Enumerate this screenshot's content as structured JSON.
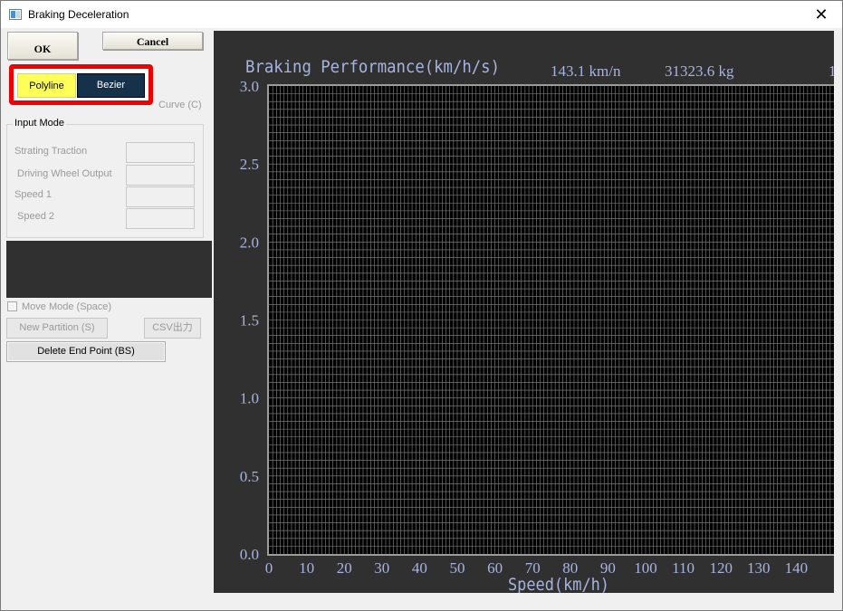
{
  "window": {
    "title": "Braking Deceleration",
    "close_glyph": "✕"
  },
  "buttons": {
    "ok": "OK",
    "cancel": "Cancel"
  },
  "curve": {
    "polyline": "Polyline",
    "bezier": "Bezier",
    "label": "Curve (C)"
  },
  "input_mode": {
    "title": "Input Mode",
    "fields": [
      {
        "label": "Strating Traction",
        "value": ""
      },
      {
        "label": "Driving Wheel Output",
        "value": ""
      },
      {
        "label": "Speed 1",
        "value": ""
      },
      {
        "label": "Speed 2",
        "value": ""
      }
    ]
  },
  "move_mode": {
    "label": "Move Mode (Space)",
    "checked": false
  },
  "actions": {
    "new_partition": "New Partition (S)",
    "csv": "CSV出力",
    "delete_end": "Delete End Point (BS)"
  },
  "chart_data": {
    "type": "line",
    "title": "Braking Performance(km/h/s)",
    "info": [
      "143.1 km/n",
      "31323.6 kg",
      "1"
    ],
    "xlabel": "Speed(km/h)",
    "ylabel": "",
    "x_ticks": [
      "0",
      "10",
      "20",
      "30",
      "40",
      "50",
      "60",
      "70",
      "80",
      "90",
      "100",
      "110",
      "120",
      "130",
      "140"
    ],
    "y_ticks": [
      "0.0",
      "0.5",
      "1.0",
      "1.5",
      "2.0",
      "2.5",
      "3.0"
    ],
    "xlim": [
      0,
      150
    ],
    "ylim": [
      0,
      3.0
    ],
    "grid": true,
    "series": [],
    "colors": {
      "background": "#303030",
      "plot": "#000000",
      "grid": "#8a8a8a",
      "text": "#a8b4e0"
    }
  }
}
